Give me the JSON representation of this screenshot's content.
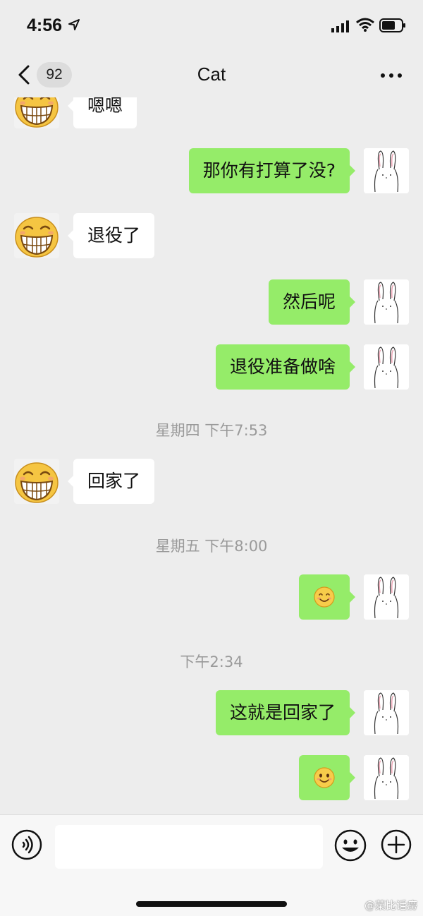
{
  "status_bar": {
    "time": "4:56",
    "icons": [
      "location-arrow-icon",
      "cellular-signal-icon",
      "wifi-icon",
      "battery-icon"
    ]
  },
  "nav": {
    "back_icon": "chevron-left-icon",
    "unread_count": "92",
    "title": "Cat",
    "more_icon": "more-dots-icon"
  },
  "messages": [
    {
      "side": "left",
      "type": "text",
      "text": "嗯嗯"
    },
    {
      "side": "right",
      "type": "text",
      "text": "那你有打算了没?"
    },
    {
      "side": "left",
      "type": "text",
      "text": "退役了"
    },
    {
      "side": "right",
      "type": "text",
      "text": "然后呢"
    },
    {
      "side": "right",
      "type": "text",
      "text": "退役准备做啥"
    },
    {
      "type": "timestamp",
      "text": "星期四 下午7:53"
    },
    {
      "side": "left",
      "type": "text",
      "text": "回家了"
    },
    {
      "type": "timestamp",
      "text": "星期五 下午8:00"
    },
    {
      "side": "right",
      "type": "emoji",
      "emoji": "blush-smile-emoji"
    },
    {
      "type": "timestamp",
      "text": "下午2:34"
    },
    {
      "side": "right",
      "type": "text",
      "text": "这就是回家了"
    },
    {
      "side": "right",
      "type": "emoji",
      "emoji": "smile-emoji"
    }
  ],
  "avatars": {
    "contact": "grinning-face-avatar",
    "self": "bunny-sketch-avatar"
  },
  "input_bar": {
    "voice_icon": "voice-icon",
    "emoji_icon": "emoji-face-icon",
    "plus_icon": "plus-circle-icon",
    "text_value": ""
  },
  "watermark": "@菜比话痨"
}
